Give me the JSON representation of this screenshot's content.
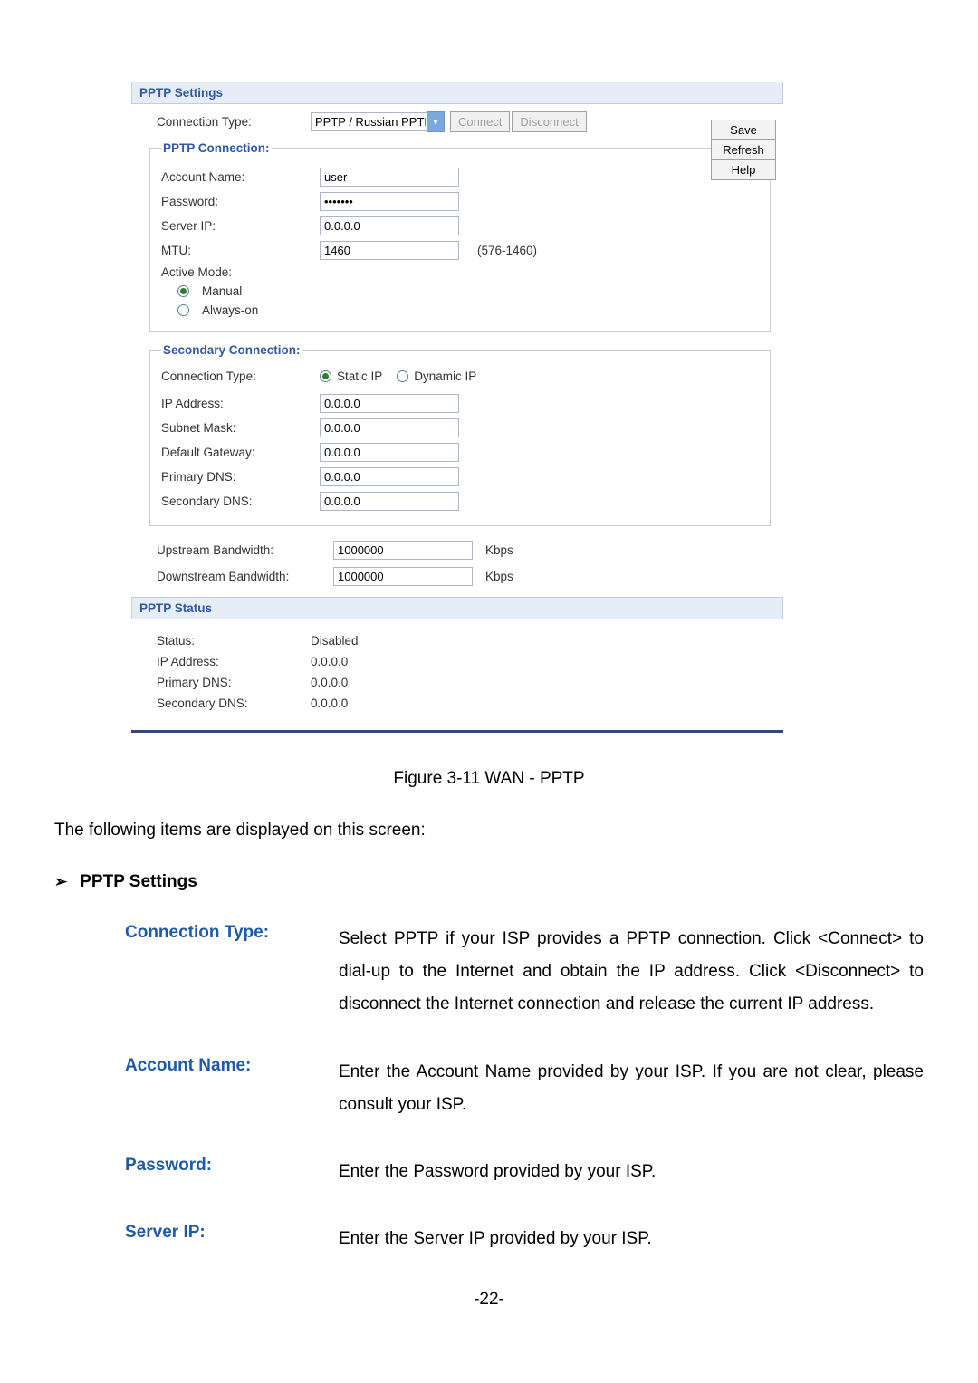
{
  "ui": {
    "settings_header": "PPTP Settings",
    "top": {
      "conn_type_label": "Connection Type:",
      "conn_type_value": "PPTP / Russian PPTP",
      "connect": "Connect",
      "disconnect": "Disconnect"
    },
    "side": {
      "save": "Save",
      "refresh": "Refresh",
      "help": "Help"
    },
    "pptp_conn": {
      "legend": "PPTP Connection:",
      "account_label": "Account Name:",
      "account_value": "user",
      "password_label": "Password:",
      "password_value": "•••••••",
      "server_label": "Server IP:",
      "server_value": "0.0.0.0",
      "mtu_label": "MTU:",
      "mtu_value": "1460",
      "mtu_hint": "(576-1460)",
      "active_label": "Active Mode:",
      "manual": "Manual",
      "always": "Always-on"
    },
    "secondary": {
      "legend": "Secondary Connection:",
      "conn_type_label": "Connection Type:",
      "static": "Static IP",
      "dynamic": "Dynamic IP",
      "ip_label": "IP Address:",
      "ip_value": "0.0.0.0",
      "subnet_label": "Subnet Mask:",
      "subnet_value": "0.0.0.0",
      "gateway_label": "Default Gateway:",
      "gateway_value": "0.0.0.0",
      "pdns_label": "Primary DNS:",
      "pdns_value": "0.0.0.0",
      "sdns_label": "Secondary DNS:",
      "sdns_value": "0.0.0.0"
    },
    "bw": {
      "up_label": "Upstream Bandwidth:",
      "up_value": "1000000",
      "down_label": "Downstream Bandwidth:",
      "down_value": "1000000",
      "unit": "Kbps"
    },
    "status_header": "PPTP Status",
    "status": {
      "status_label": "Status:",
      "status_value": "Disabled",
      "ip_label": "IP Address:",
      "ip_value": "0.0.0.0",
      "pdns_label": "Primary DNS:",
      "pdns_value": "0.0.0.0",
      "sdns_label": "Secondary DNS:",
      "sdns_value": "0.0.0.0"
    }
  },
  "figure_caption": "Figure 3-11 WAN - PPTP",
  "intro_text": "The following items are displayed on this screen:",
  "section_name": "PPTP Settings",
  "defs": {
    "conn_type": {
      "term": "Connection Type:",
      "desc": "Select PPTP if your ISP provides a PPTP connection. Click <Connect> to dial-up to the Internet and obtain the IP address. Click <Disconnect> to disconnect the Internet connection and release the current IP address."
    },
    "account": {
      "term": "Account Name:",
      "desc": "Enter the Account Name provided by your ISP. If you are not clear, please consult your ISP."
    },
    "password": {
      "term": "Password:",
      "desc": "Enter the Password provided by your ISP."
    },
    "server": {
      "term": "Server IP:",
      "desc": "Enter the Server IP provided by your ISP."
    }
  },
  "page_number": "-22-"
}
